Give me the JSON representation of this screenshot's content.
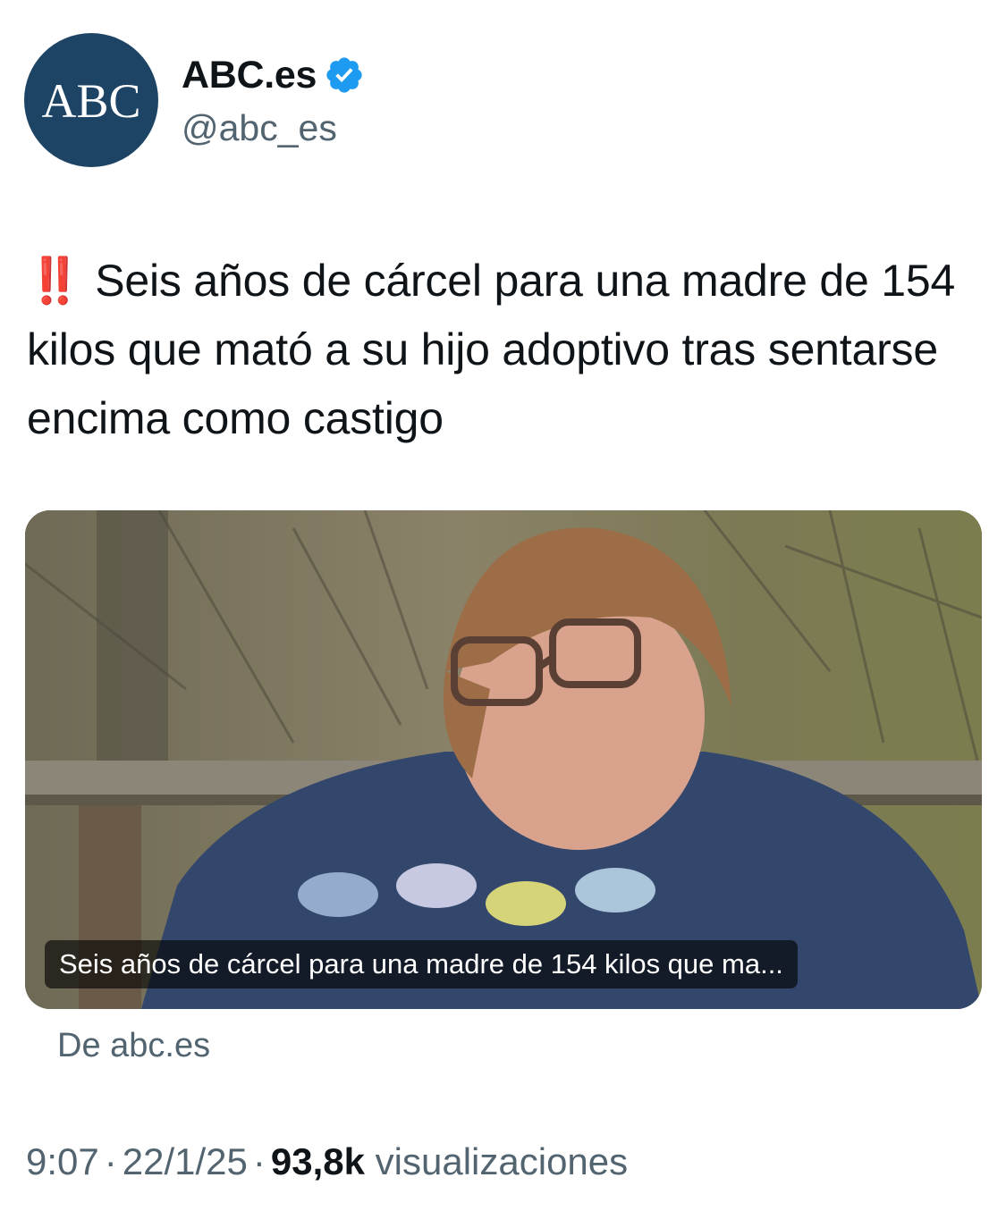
{
  "author": {
    "avatar_text": "ABC",
    "display_name": "ABC.es",
    "handle": "@abc_es",
    "verified_icon": "verified-badge-icon",
    "avatar_color": "#1d4465",
    "verified_color": "#1d9bf0"
  },
  "tweet": {
    "emoji": "‼️",
    "text": "Seis años de cárcel para una madre de 154 kilos que mató a su hijo adoptivo tras sentarse encima como castigo"
  },
  "card": {
    "image_subject": "woman-in-blue-tshirt-photo",
    "caption": "Seis años de cárcel para una madre de 154 kilos que ma...",
    "source": "De abc.es"
  },
  "meta": {
    "time": "9:07",
    "separator": "·",
    "date": "22/1/25",
    "views_count": "93,8k",
    "views_label": "visualizaciones"
  }
}
